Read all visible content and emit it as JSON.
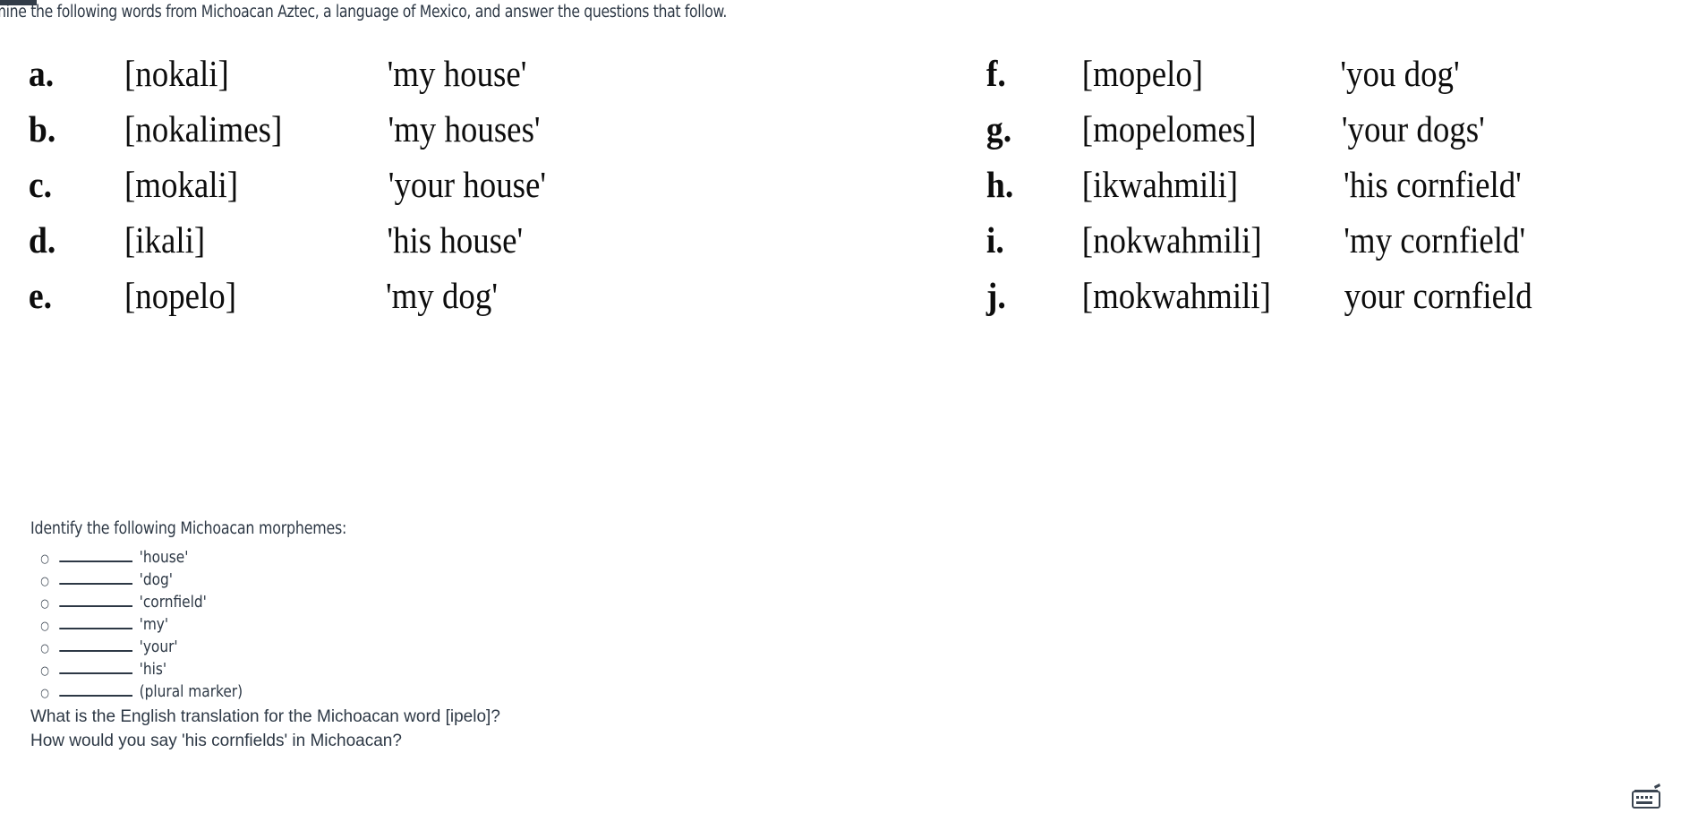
{
  "page": {
    "intro": "Examine the following words from Michoacan Aztec, a language of Mexico, and answer the questions that follow."
  },
  "word_list": {
    "left_column": [
      {
        "letter": "a.",
        "form": "[nokali]",
        "gloss": "'my house'"
      },
      {
        "letter": "b.",
        "form": "[nokalimes]",
        "gloss": "'my houses'"
      },
      {
        "letter": "c.",
        "form": "[mokali]",
        "gloss": "'your house'"
      },
      {
        "letter": "d.",
        "form": "[ikali]",
        "gloss": "'his house'"
      },
      {
        "letter": "e.",
        "form": "[nopelo]",
        "gloss": "'my dog'"
      }
    ],
    "right_column": [
      {
        "letter": "f.",
        "form": "[mopelo]",
        "gloss": "'you dog'"
      },
      {
        "letter": "g.",
        "form": "[mopelomes]",
        "gloss": "'your dogs'"
      },
      {
        "letter": "h.",
        "form": "[ikwahmili]",
        "gloss": "'his cornfield'"
      },
      {
        "letter": "i.",
        "form": "[nokwahmili]",
        "gloss": "'my cornfield'"
      },
      {
        "letter": "j.",
        "form": "[mokwahmili]",
        "gloss": "your cornfield"
      }
    ]
  },
  "questions": {
    "heading": "Identify the following Michoacan morphemes:",
    "bullet_glyph": "○",
    "blank": "________",
    "morphemes": [
      "'house'",
      "'dog'",
      "'cornfield'",
      "'my'",
      "'your'",
      "'his'",
      "(plural marker)"
    ],
    "final": [
      "What is the English translation for the Michoacan word [ipelo]?",
      "How would you say 'his cornfields' in Michoacan?"
    ]
  },
  "colors": {
    "text": "#2d3845",
    "serif_text": "#0d0d0d",
    "marker_bar": "#323c48",
    "background": "#ffffff"
  }
}
